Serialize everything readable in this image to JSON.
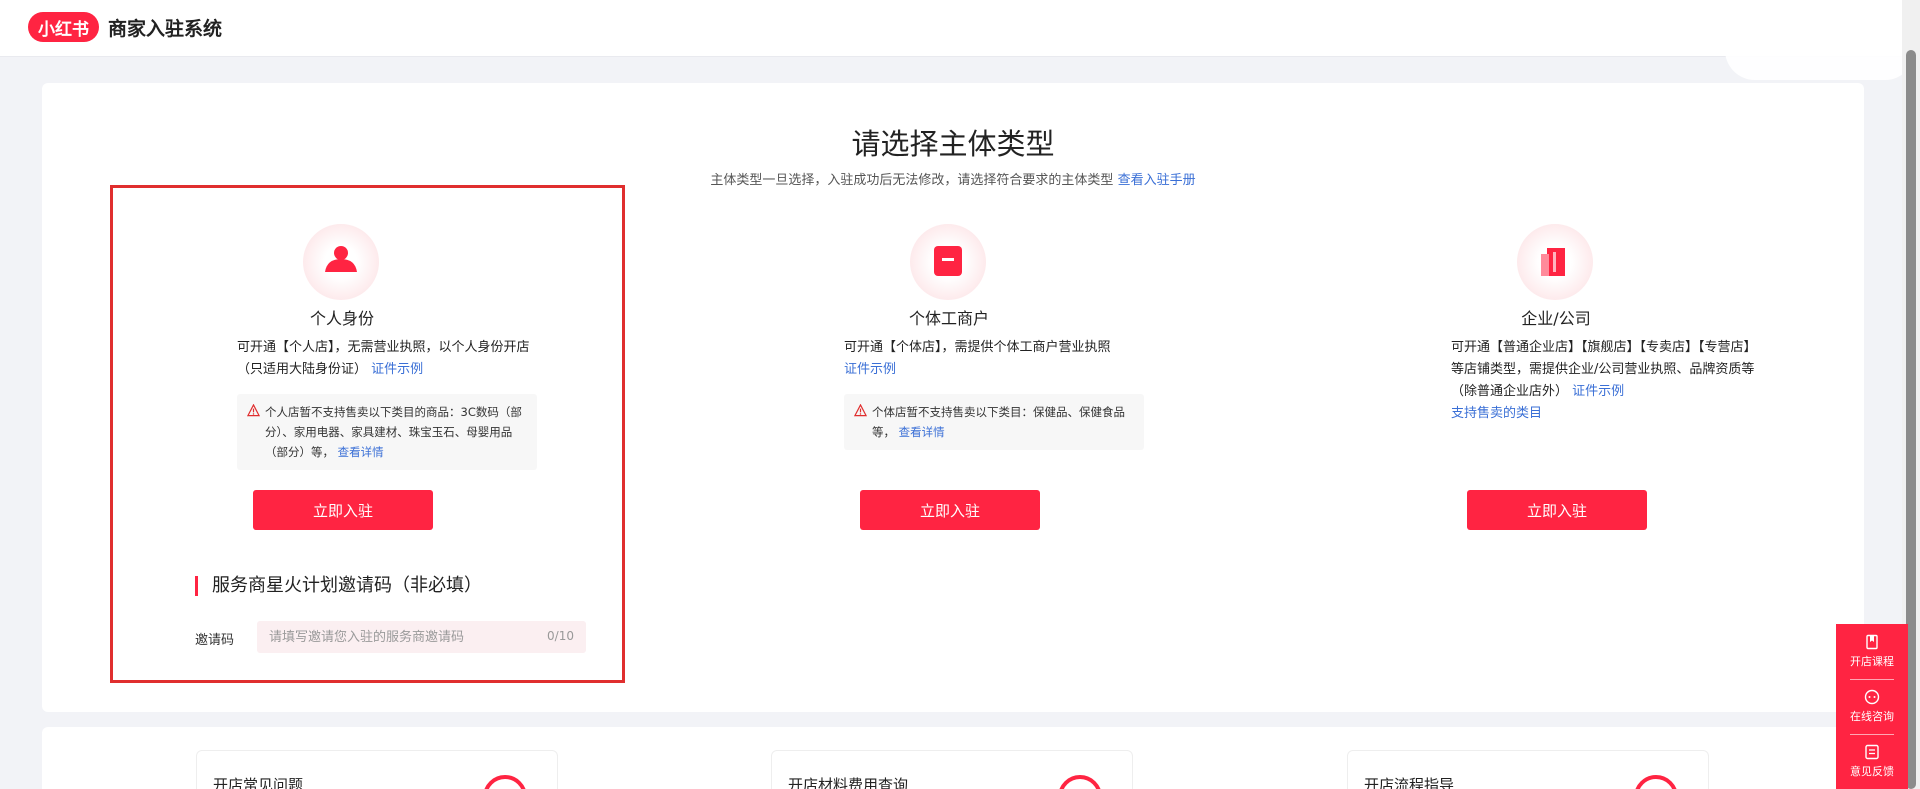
{
  "header": {
    "logo_text": "小红书",
    "brand_title": "商家入驻系统"
  },
  "page": {
    "title": "请选择主体类型",
    "subtitle": "主体类型一旦选择，入驻成功后无法修改，请选择符合要求的主体类型",
    "manual_link": "查看入驻手册"
  },
  "options": [
    {
      "title": "个人身份",
      "desc": "可开通【个人店】，无需营业执照，以个人身份开店（只适用大陆身份证）",
      "link": "证件示例",
      "warning": "个人店暂不支持售卖以下类目的商品：3C数码（部分）、家用电器、家具建材、珠宝玉石、母婴用品（部分）等，",
      "warning_link": "查看详情",
      "button": "立即入驻"
    },
    {
      "title": "个体工商户",
      "desc": "可开通【个体店】，需提供个体工商户营业执照",
      "link": "证件示例",
      "warning": "个体店暂不支持售卖以下类目：保健品、保健食品等，",
      "warning_link": "查看详情",
      "button": "立即入驻"
    },
    {
      "title": "企业/公司",
      "desc": "可开通【普通企业店】【旗舰店】【专卖店】【专营店】等店铺类型，需提供企业/公司营业执照、品牌资质等（除普通企业店外）",
      "link": "证件示例",
      "link2": "支持售卖的类目",
      "button": "立即入驻"
    }
  ],
  "invite": {
    "section_title": "服务商星火计划邀请码（非必填）",
    "label": "邀请码",
    "placeholder": "请填写邀请您入驻的服务商邀请码",
    "counter": "0/10"
  },
  "help_cards": [
    {
      "title": "开店常见问题"
    },
    {
      "title": "开店材料费用查询"
    },
    {
      "title": "开店流程指导"
    }
  ],
  "float_menu": [
    {
      "label": "开店课程",
      "icon": "bookmark-icon"
    },
    {
      "label": "在线咨询",
      "icon": "chat-icon"
    },
    {
      "label": "意见反馈",
      "icon": "feedback-icon"
    }
  ],
  "colors": {
    "brand": "#ff2442",
    "link": "#3a6fd6",
    "highlight_border": "#e02e2e"
  }
}
